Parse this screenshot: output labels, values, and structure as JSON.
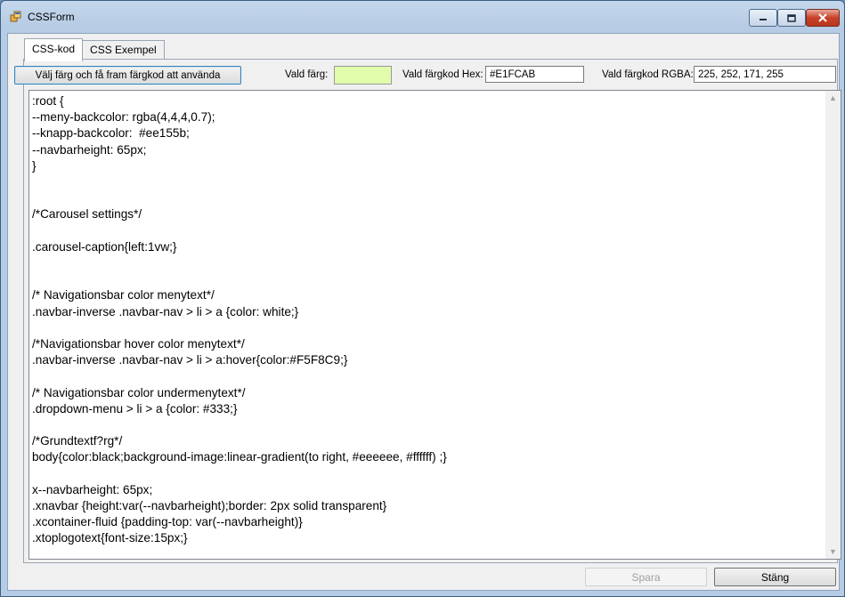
{
  "window": {
    "title": "CSSForm"
  },
  "tabs": [
    {
      "label": "CSS-kod"
    },
    {
      "label": "CSS Exempel"
    }
  ],
  "controls": {
    "pick_button_label": "Välj färg och få fram färgkod att använda",
    "chosen_color_label": "Vald färg:",
    "chosen_color_value": "#E1FCAB",
    "hex_label": "Vald färgkod Hex:",
    "hex_value": "#E1FCAB",
    "rgba_label": "Vald färgkod RGBA:",
    "rgba_value": "225, 252, 171, 255"
  },
  "editor": {
    "content": ":root {\n--meny-backcolor: rgba(4,4,4,0.7);\n--knapp-backcolor:  #ee155b;\n--navbarheight: 65px;\n}\n\n\n/*Carousel settings*/\n\n.carousel-caption{left:1vw;}\n\n\n/* Navigationsbar color menytext*/\n.navbar-inverse .navbar-nav > li > a {color: white;}\n\n/*Navigationsbar hover color menytext*/\n.navbar-inverse .navbar-nav > li > a:hover{color:#F5F8C9;}\n\n/* Navigationsbar color undermenytext*/\n.dropdown-menu > li > a {color: #333;}\n\n/*Grundtextf?rg*/\nbody{color:black;background-image:linear-gradient(to right, #eeeeee, #ffffff) ;}\n\nx--navbarheight: 65px;\n.xnavbar {height:var(--navbarheight);border: 2px solid transparent}\n.xcontainer-fluid {padding-top: var(--navbarheight)}\n.xtoplogotext{font-size:15px;}"
  },
  "footer": {
    "save_label": "Spara",
    "close_label": "Stäng"
  }
}
